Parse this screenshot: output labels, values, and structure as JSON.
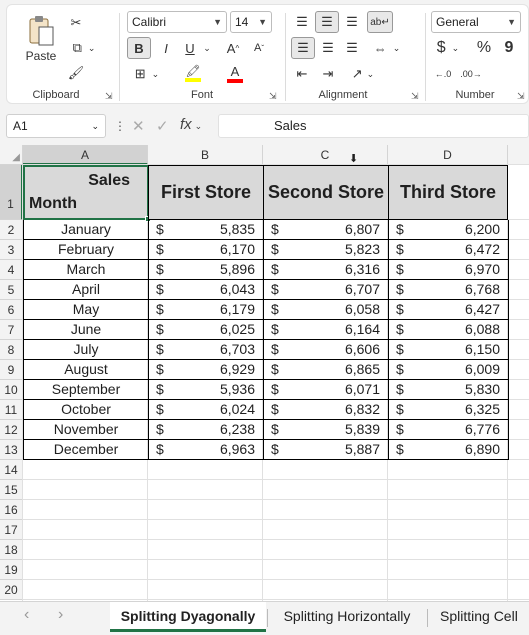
{
  "ribbon": {
    "clipboard": {
      "label": "Clipboard",
      "paste_label": "Paste"
    },
    "font": {
      "label": "Font",
      "family": "Calibri",
      "size": "14",
      "bold": "B",
      "italic": "I",
      "underline": "U"
    },
    "alignment": {
      "label": "Alignment"
    },
    "number": {
      "label": "Number",
      "format": "General",
      "currency": "$",
      "percent": "%",
      "comma": "9"
    },
    "colors": {
      "highlight": "#ffff00",
      "font_color": "#ff0000",
      "accent": "#217346"
    }
  },
  "formula_bar": {
    "name_box": "A1",
    "formula_text": "Sales",
    "fx": "fx"
  },
  "sheet": {
    "columns": [
      "A",
      "B",
      "C",
      "D"
    ],
    "row_numbers": [
      "1",
      "2",
      "3",
      "4",
      "5",
      "6",
      "7",
      "8",
      "9",
      "10",
      "11",
      "12",
      "13",
      "14",
      "15",
      "16",
      "17",
      "18",
      "19",
      "20"
    ],
    "header": {
      "a_top": "Sales",
      "a_bottom": "Month",
      "b": "First Store",
      "c": "Second Store",
      "d": "Third Store"
    },
    "currency_symbol": "$",
    "rows": [
      {
        "month": "January",
        "b": "5,835",
        "c": "6,807",
        "d": "6,200"
      },
      {
        "month": "February",
        "b": "6,170",
        "c": "5,823",
        "d": "6,472"
      },
      {
        "month": "March",
        "b": "5,896",
        "c": "6,316",
        "d": "6,970"
      },
      {
        "month": "April",
        "b": "6,043",
        "c": "6,707",
        "d": "6,768"
      },
      {
        "month": "May",
        "b": "6,179",
        "c": "6,058",
        "d": "6,427"
      },
      {
        "month": "June",
        "b": "6,025",
        "c": "6,164",
        "d": "6,088"
      },
      {
        "month": "July",
        "b": "6,703",
        "c": "6,606",
        "d": "6,150"
      },
      {
        "month": "August",
        "b": "6,929",
        "c": "6,865",
        "d": "6,009"
      },
      {
        "month": "September",
        "b": "5,936",
        "c": "6,071",
        "d": "5,830"
      },
      {
        "month": "October",
        "b": "6,024",
        "c": "6,832",
        "d": "6,325"
      },
      {
        "month": "November",
        "b": "6,238",
        "c": "5,839",
        "d": "6,776"
      },
      {
        "month": "December",
        "b": "6,963",
        "c": "5,887",
        "d": "6,890"
      }
    ]
  },
  "tabs": [
    {
      "label": "Splitting Dyagonally",
      "active": true
    },
    {
      "label": "Splitting Horizontally",
      "active": false
    },
    {
      "label": "Splitting Cell",
      "active": false
    }
  ]
}
